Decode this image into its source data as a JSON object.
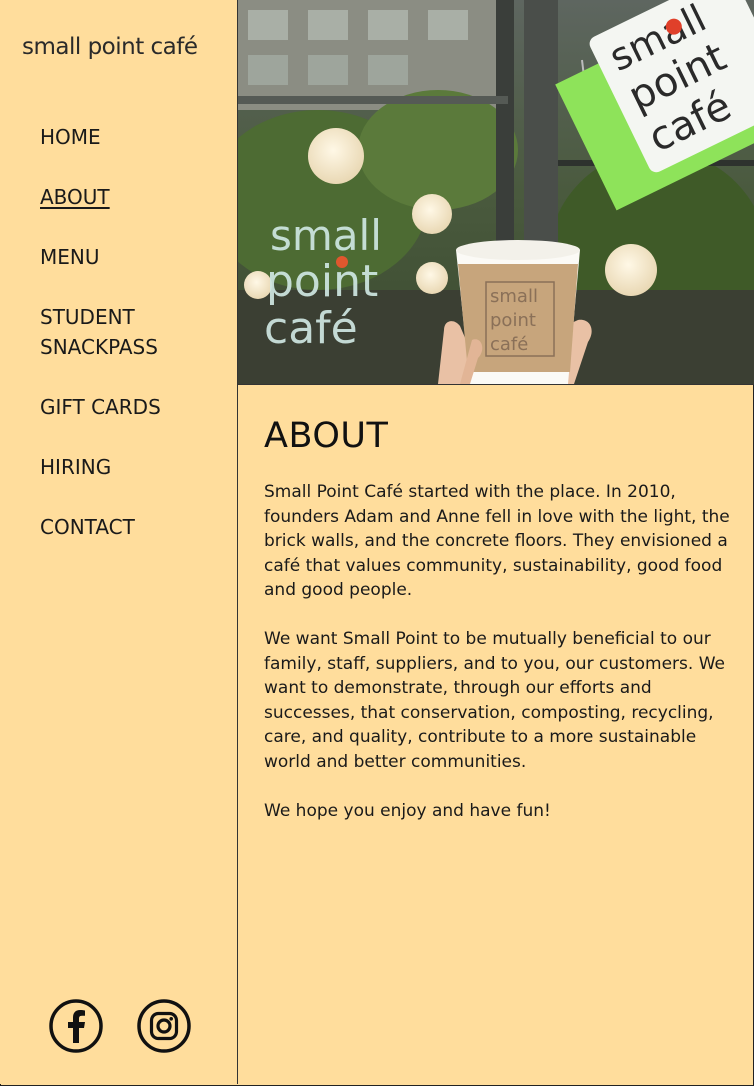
{
  "brand": {
    "logo_text": "small point café",
    "accent": "#e0572e",
    "background": "#ffdd9c"
  },
  "nav": {
    "items": [
      {
        "label": "HOME"
      },
      {
        "label": "ABOUT",
        "active": true
      },
      {
        "label": "MENU"
      },
      {
        "label": "STUDENT SNACKPASS"
      },
      {
        "label": "GIFT CARDS"
      },
      {
        "label": "HIRING"
      },
      {
        "label": "CONTACT"
      }
    ]
  },
  "hero": {
    "window_sign": [
      "small",
      "point",
      "café"
    ],
    "hanging_sign": [
      "small",
      "point",
      "café"
    ],
    "cup_sleeve": [
      "small",
      "point",
      "café"
    ]
  },
  "about": {
    "heading": "ABOUT",
    "paragraphs": [
      "Small Point Café started with the place. In 2010, founders Adam and Anne fell in love with the light, the brick walls, and the concrete floors. They envisioned a café that values community, sustainability, good food and good people.",
      "We want Small Point to be mutually beneficial to our family, staff, suppliers, and to you, our customers. We want to demonstrate, through our efforts and successes, that conservation, composting, recycling, care, and quality, contribute to a more sustainable world and better communities.",
      "We hope you enjoy and have fun!"
    ]
  },
  "social": {
    "icons": [
      "facebook-icon",
      "instagram-icon"
    ]
  }
}
